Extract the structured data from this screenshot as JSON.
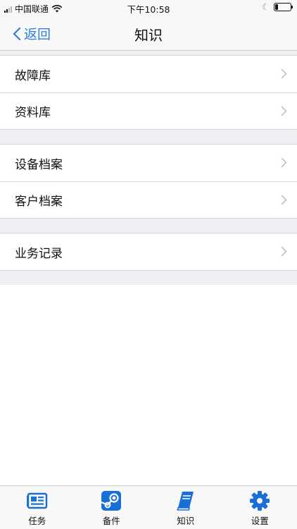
{
  "status_bar": {
    "carrier": "中国联通",
    "time": "下午10:58",
    "battery_level": 0.2
  },
  "nav": {
    "back_label": "返回",
    "title": "知识"
  },
  "groups": [
    {
      "items": [
        {
          "label": "故障库"
        },
        {
          "label": "资料库"
        }
      ]
    },
    {
      "items": [
        {
          "label": "设备档案"
        },
        {
          "label": "客户档案"
        }
      ]
    },
    {
      "items": [
        {
          "label": "业务记录"
        }
      ]
    }
  ],
  "tabs": [
    {
      "label": "任务",
      "icon": "newspaper-icon"
    },
    {
      "label": "备件",
      "icon": "steam-icon"
    },
    {
      "label": "知识",
      "icon": "book-icon"
    },
    {
      "label": "设置",
      "icon": "gear-icon"
    }
  ],
  "colors": {
    "accent": "#2b7fe0",
    "icon_blue": "#1a6fd6",
    "group_gap": "#efeff4",
    "separator": "#d6d6d9"
  }
}
